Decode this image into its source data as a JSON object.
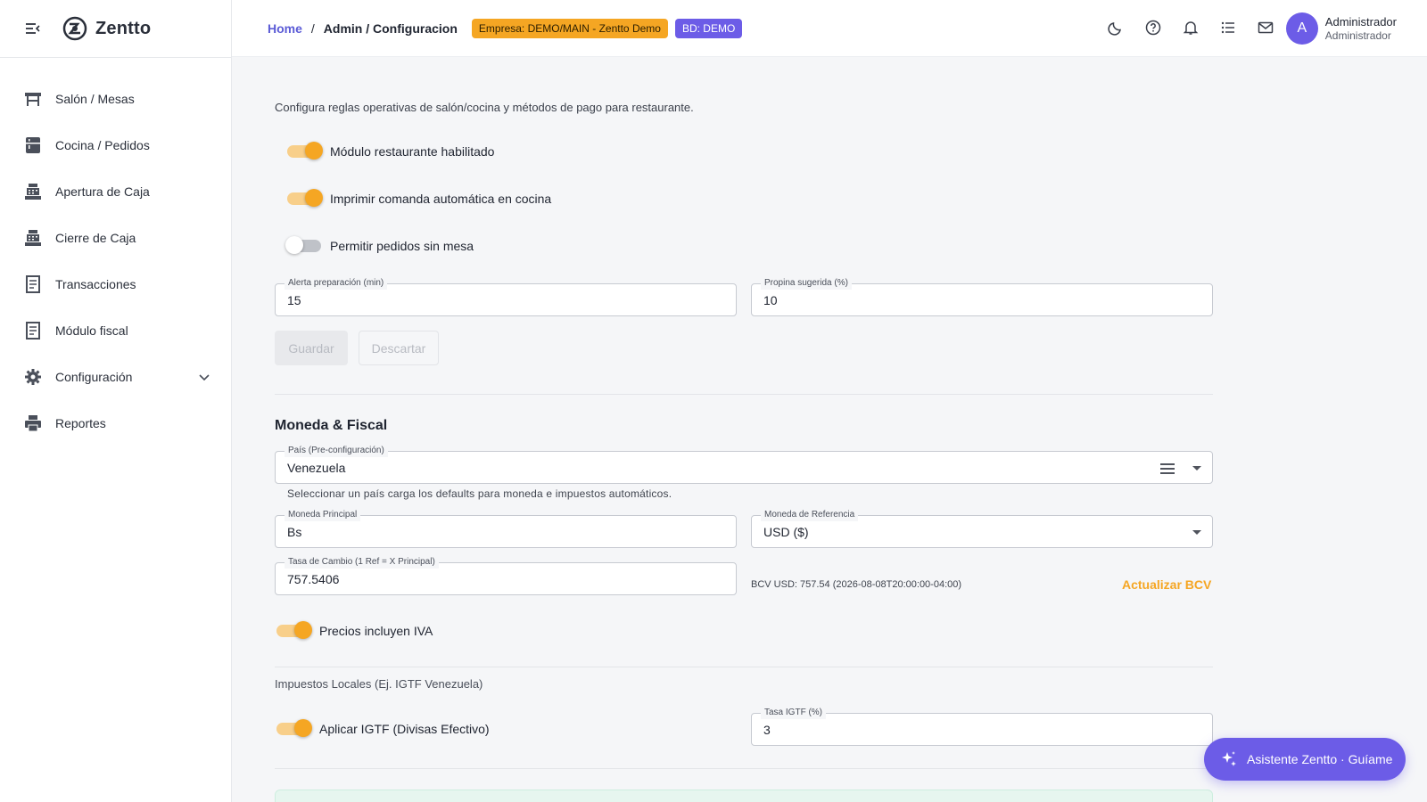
{
  "app": {
    "name": "Zentto"
  },
  "sidebar": {
    "items": [
      {
        "label": "Salón / Mesas",
        "icon": "table-icon"
      },
      {
        "label": "Cocina / Pedidos",
        "icon": "kitchen-icon"
      },
      {
        "label": "Apertura de Caja",
        "icon": "cash-register-icon"
      },
      {
        "label": "Cierre de Caja",
        "icon": "cash-register-icon"
      },
      {
        "label": "Transacciones",
        "icon": "receipt-icon"
      },
      {
        "label": "Módulo fiscal",
        "icon": "receipt-icon"
      },
      {
        "label": "Configuración",
        "icon": "gear-icon"
      },
      {
        "label": "Reportes",
        "icon": "printer-icon"
      }
    ]
  },
  "header": {
    "breadcrumb_home": "Home",
    "breadcrumb_sep": "/",
    "breadcrumb_current": "Admin / Configuracion",
    "company_badge": "Empresa: DEMO/MAIN - Zentto Demo",
    "db_badge": "BD: DEMO",
    "user": {
      "initial": "A",
      "name": "Administrador",
      "role": "Administrador"
    }
  },
  "restaurant": {
    "description": "Configura reglas operativas de salón/cocina y métodos de pago para restaurante.",
    "toggles": [
      {
        "label": "Módulo restaurante habilitado",
        "on": true
      },
      {
        "label": "Imprimir comanda automática en cocina",
        "on": true
      },
      {
        "label": "Permitir pedidos sin mesa",
        "on": false
      }
    ],
    "prep_alert": {
      "label": "Alerta preparación (min)",
      "value": "15"
    },
    "tip": {
      "label": "Propina sugerida (%)",
      "value": "10"
    },
    "save_label": "Guardar",
    "discard_label": "Descartar"
  },
  "currency": {
    "title": "Moneda & Fiscal",
    "country": {
      "label": "País (Pre-configuración)",
      "value": "Venezuela",
      "helper": "Seleccionar un país carga los defaults para moneda e impuestos automáticos."
    },
    "main_currency": {
      "label": "Moneda Principal",
      "value": "Bs"
    },
    "ref_currency": {
      "label": "Moneda de Referencia",
      "value": "USD ($)"
    },
    "rate": {
      "label": "Tasa de Cambio (1 Ref = X Principal)",
      "value": "757.5406"
    },
    "bcv_info": "BCV USD: 757.54 (2026-08-08T20:00:00-04:00)",
    "bcv_update": "Actualizar BCV",
    "prices_iva": {
      "label": "Precios incluyen IVA",
      "on": true
    },
    "local_taxes_title": "Impuestos Locales (Ej. IGTF Venezuela)",
    "igtf_toggle": {
      "label": "Aplicar IGTF (Divisas Efectivo)",
      "on": true
    },
    "igtf_rate": {
      "label": "Tasa IGTF (%)",
      "value": "3"
    }
  },
  "assistant": {
    "label": "Asistente Zentto · Guíame"
  },
  "colors": {
    "accent": "#6c5ce7",
    "orange": "#f5a623"
  }
}
